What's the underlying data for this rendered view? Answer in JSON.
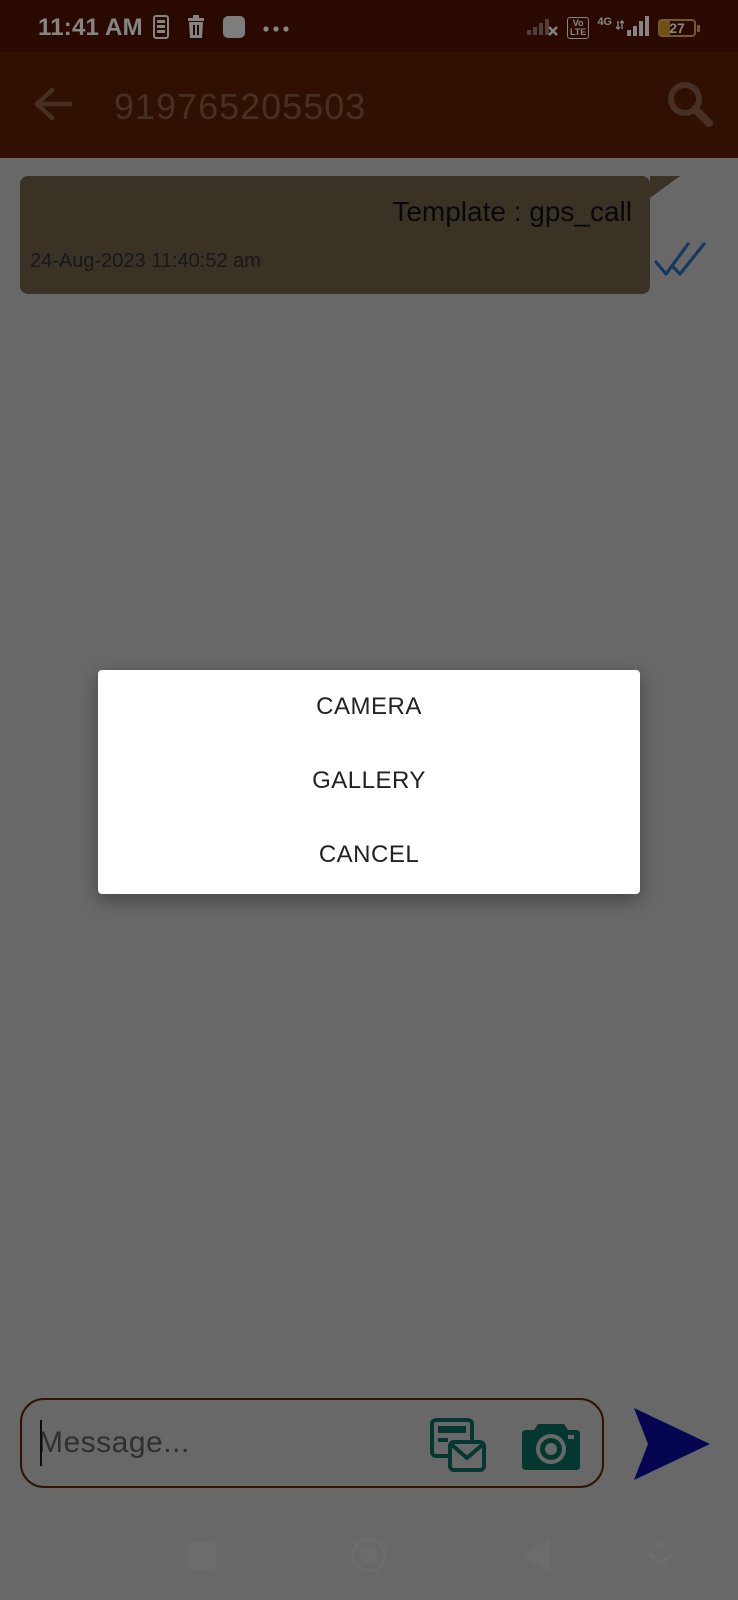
{
  "status_bar": {
    "time": "11:41 AM",
    "network_type": "4G",
    "volte_label_1": "Vo",
    "volte_label_2": "LTE",
    "battery_level": "27"
  },
  "app_bar": {
    "title": "919765205503",
    "back_icon": "arrow-left-icon",
    "search_icon": "search-icon"
  },
  "chat": {
    "messages": [
      {
        "text": "Template : gps_call",
        "timestamp": "24-Aug-2023 11:40:52 am",
        "status": "read"
      }
    ]
  },
  "composer": {
    "placeholder": "Message...",
    "value": ""
  },
  "dialog": {
    "options": [
      {
        "label": "CAMERA"
      },
      {
        "label": "GALLERY"
      },
      {
        "label": "CANCEL"
      }
    ]
  },
  "colors": {
    "status_bar": "#521400",
    "app_bar": "#5c1f00",
    "accent_teal": "#0b6a5e",
    "send_blue": "#0a0a9c",
    "tick_blue": "#2a6fb0"
  }
}
